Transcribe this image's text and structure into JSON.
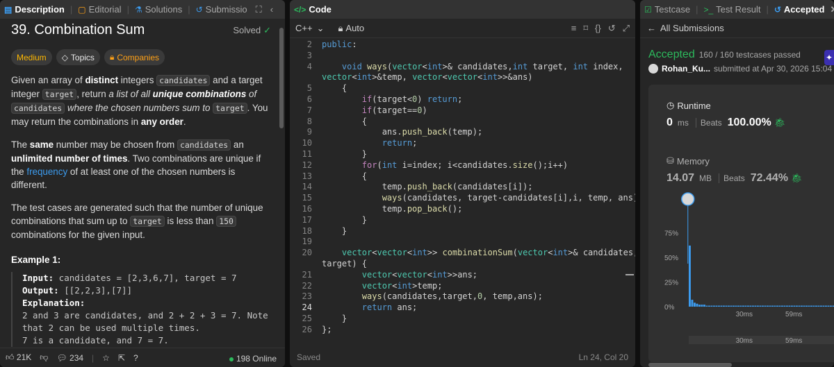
{
  "left": {
    "tabs": [
      {
        "label": "Description",
        "icon": "description-icon"
      },
      {
        "label": "Editorial",
        "icon": "book-icon"
      },
      {
        "label": "Solutions",
        "icon": "flask-icon"
      },
      {
        "label": "Submissio",
        "icon": "history-icon"
      }
    ],
    "title": "39. Combination Sum",
    "solved": "Solved",
    "tags": {
      "difficulty": "Medium",
      "topics": "Topics",
      "companies": "Companies"
    },
    "para1": {
      "a": "Given an array of ",
      "b": "distinct",
      "c": " integers ",
      "d": "candidates",
      "e": " and a target integer ",
      "f": "target",
      "g": ", return ",
      "h": "a list of all ",
      "i": "unique combinations",
      "j": " of ",
      "k": "candidates",
      "l": " where the chosen numbers sum to ",
      "m": "target",
      "n": ". You may return the combinations in ",
      "o": "any order",
      "p": "."
    },
    "para2": {
      "a": "The ",
      "b": "same",
      "c": " number may be chosen from ",
      "d": "candidates",
      "e": " an ",
      "f": "unlimited number of times",
      "g": ". Two combinations are unique if the ",
      "h": "frequency",
      "i": " of at least one of the chosen numbers is different."
    },
    "para3": {
      "a": "The test cases are generated such that the number of unique combinations that sum up to ",
      "b": "target",
      "c": " is less than ",
      "d": "150",
      "e": " combinations for the given input."
    },
    "example_title": "Example 1:",
    "example": {
      "input_label": "Input:",
      "input_value": " candidates = [2,3,6,7], target = 7",
      "output_label": "Output:",
      "output_value": " [[2,2,3],[7]]",
      "explanation_label": "Explanation:",
      "line1": "2 and 3 are candidates, and 2 + 2 + 3 = 7. Note",
      "line2": "that 2 can be used multiple times.",
      "line3": "7 is a candidate, and 7 = 7."
    },
    "footer": {
      "likes": "21K",
      "comments": "234",
      "online": "198 Online"
    }
  },
  "editor": {
    "tab": "Code",
    "language": "C++",
    "mode": "Auto",
    "status_left": "Saved",
    "status_right": "Ln 24, Col 20",
    "lines": [
      {
        "n": "2",
        "t": "public:"
      },
      {
        "n": "3",
        "t": ""
      },
      {
        "n": "4",
        "t": "    void ways(vector<int>& candidates,int target, int index,"
      },
      {
        "n": "",
        "t": "vector<int>&temp, vector<vector<int>>&ans)"
      },
      {
        "n": "5",
        "t": "    {"
      },
      {
        "n": "6",
        "t": "        if(target<0) return;"
      },
      {
        "n": "7",
        "t": "        if(target==0)"
      },
      {
        "n": "8",
        "t": "        {"
      },
      {
        "n": "9",
        "t": "            ans.push_back(temp);"
      },
      {
        "n": "10",
        "t": "            return;"
      },
      {
        "n": "11",
        "t": "        }"
      },
      {
        "n": "12",
        "t": "        for(int i=index; i<candidates.size();i++)"
      },
      {
        "n": "13",
        "t": "        {"
      },
      {
        "n": "14",
        "t": "            temp.push_back(candidates[i]);"
      },
      {
        "n": "15",
        "t": "            ways(candidates, target-candidates[i],i, temp, ans);"
      },
      {
        "n": "16",
        "t": "            temp.pop_back();"
      },
      {
        "n": "17",
        "t": "        }"
      },
      {
        "n": "18",
        "t": "    }"
      },
      {
        "n": "19",
        "t": ""
      },
      {
        "n": "20",
        "t": "    vector<vector<int>> combinationSum(vector<int>& candidates, int"
      },
      {
        "n": "",
        "t": "target) {"
      },
      {
        "n": "21",
        "t": "        vector<vector<int>>ans;"
      },
      {
        "n": "22",
        "t": "        vector<int>temp;"
      },
      {
        "n": "23",
        "t": "        ways(candidates,target,0, temp,ans);"
      },
      {
        "n": "24",
        "t": "        return ans;"
      },
      {
        "n": "25",
        "t": "    }"
      },
      {
        "n": "26",
        "t": "};"
      }
    ]
  },
  "right": {
    "tabs": [
      {
        "label": "Testcase",
        "icon": "check-square-icon"
      },
      {
        "label": "Test Result",
        "icon": "terminal-icon"
      },
      {
        "label": "Accepted",
        "icon": "history-icon"
      }
    ],
    "back": "All Submissions",
    "status": "Accepted",
    "passed": "160 / 160 testcases passed",
    "user": "Rohan_Ku...",
    "submitted": "submitted at Apr 30, 2026 15:04",
    "runtime_label": "Runtime",
    "runtime_value": "0",
    "runtime_unit": "ms",
    "runtime_beats_label": "Beats",
    "runtime_beats": "100.00%",
    "memory_label": "Memory",
    "memory_value": "14.07",
    "memory_unit": "MB",
    "memory_beats_label": "Beats",
    "memory_beats": "72.44%",
    "colors": {
      "accent": "#2cbb5d",
      "bars": "#3c9cf0"
    }
  },
  "chart_data": {
    "type": "bar",
    "title": "",
    "xlabel": "",
    "ylabel": "",
    "y_ticks": [
      "75%",
      "50%",
      "25%",
      "0%"
    ],
    "x_ticks": [
      "30ms",
      "59ms"
    ],
    "ylim": [
      0,
      100
    ],
    "values": [
      62,
      7,
      4,
      3,
      2,
      2,
      2,
      1,
      1,
      1,
      1,
      1,
      1,
      1,
      1,
      1,
      1,
      1,
      1,
      1,
      1,
      1,
      1,
      1,
      1,
      1,
      1,
      1,
      1,
      1,
      1,
      1,
      1,
      1,
      1,
      1,
      1,
      1,
      1,
      1,
      1,
      1,
      1,
      1,
      1,
      1,
      1,
      1,
      1,
      1,
      1,
      1,
      1,
      1,
      1,
      1,
      1,
      1,
      1,
      1
    ]
  }
}
